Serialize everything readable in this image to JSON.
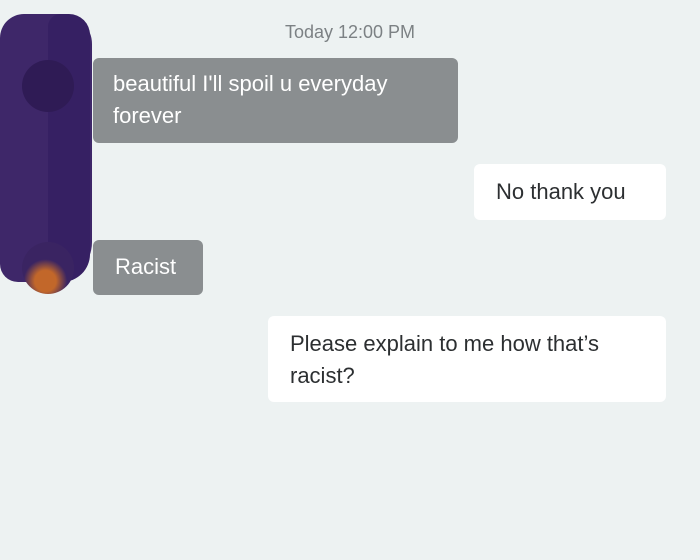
{
  "conversation": {
    "timestamp": "Today 12:00 PM",
    "messages": [
      {
        "direction": "incoming",
        "text": "beautiful I'll spoil u everyday forever"
      },
      {
        "direction": "outgoing",
        "text": "No thank you"
      },
      {
        "direction": "incoming",
        "text": "Racist"
      },
      {
        "direction": "outgoing",
        "text": "Please explain to me how that’s racist?"
      }
    ]
  },
  "colors": {
    "background": "#edf2f2",
    "incoming_bubble": "#8a8e90",
    "outgoing_bubble": "#ffffff",
    "redaction": "#3e2769"
  }
}
